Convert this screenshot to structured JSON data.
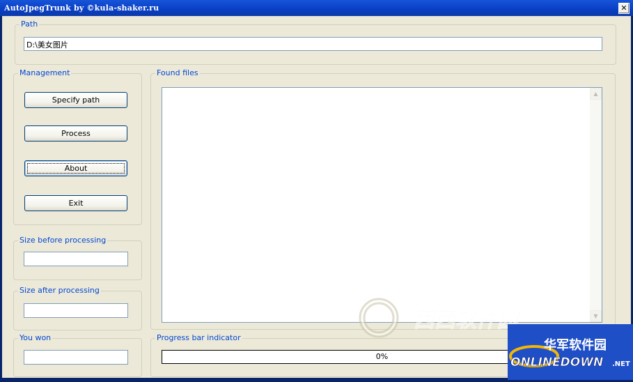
{
  "window": {
    "title": "AutoJpegTrunk by ©kula-shaker.ru",
    "close_glyph": "✕"
  },
  "path": {
    "legend": "Path",
    "value": "D:\\美女图片"
  },
  "management": {
    "legend": "Management",
    "buttons": {
      "specify": "Specify path",
      "process": "Process",
      "about": "About",
      "exit": "Exit"
    }
  },
  "size_before": {
    "legend": "Size before processing",
    "value": ""
  },
  "size_after": {
    "legend": "Size after processing",
    "value": ""
  },
  "you_won": {
    "legend": "You won",
    "value": ""
  },
  "found_files": {
    "legend": "Found files",
    "items": []
  },
  "progress": {
    "legend": "Progress bar indicator",
    "value_text": "0%",
    "fraction": 0
  },
  "watermarks": {
    "xixi": "西西软件园",
    "online_cn": "华军软件园",
    "online_en": "ONLINEDOWN",
    "online_suffix": ".NET"
  },
  "colors": {
    "title_bar": "#0a3ec4",
    "group_legend": "#0046d5",
    "dialog_bg": "#ece9d8"
  }
}
